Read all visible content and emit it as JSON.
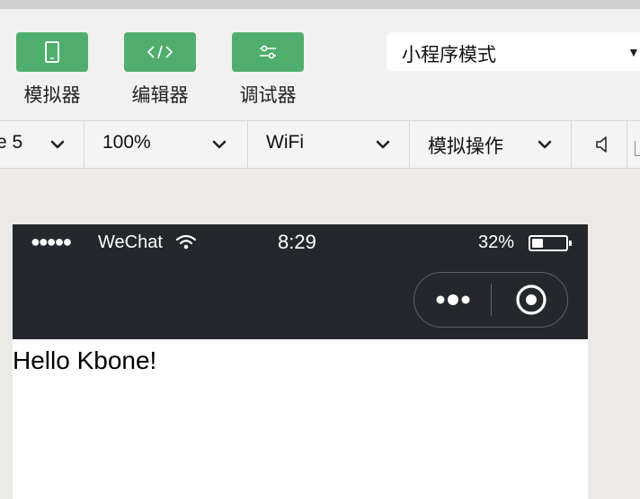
{
  "toolbar": {
    "buttons": [
      {
        "icon": "phone-icon",
        "label": "模拟器"
      },
      {
        "icon": "code-icon",
        "label": "编辑器"
      },
      {
        "icon": "debug-sliders-icon",
        "label": "调试器"
      }
    ],
    "mode": {
      "value": "小程序模式"
    }
  },
  "sim_bar": {
    "device": "e 5",
    "zoom": "100%",
    "network": "WiFi",
    "operation": "模拟操作"
  },
  "phone": {
    "status": {
      "signal_dots": "●●●●●",
      "carrier": "WeChat",
      "time": "8:29",
      "battery_pct": "32%",
      "battery_level": 0.32
    },
    "content_text": "Hello Kbone!"
  },
  "colors": {
    "accent_green": "#4fae6d",
    "status_bar_bg": "#24272c",
    "toolbar_bg": "#f1f1f1",
    "canvas_bg": "#ebeae6"
  }
}
